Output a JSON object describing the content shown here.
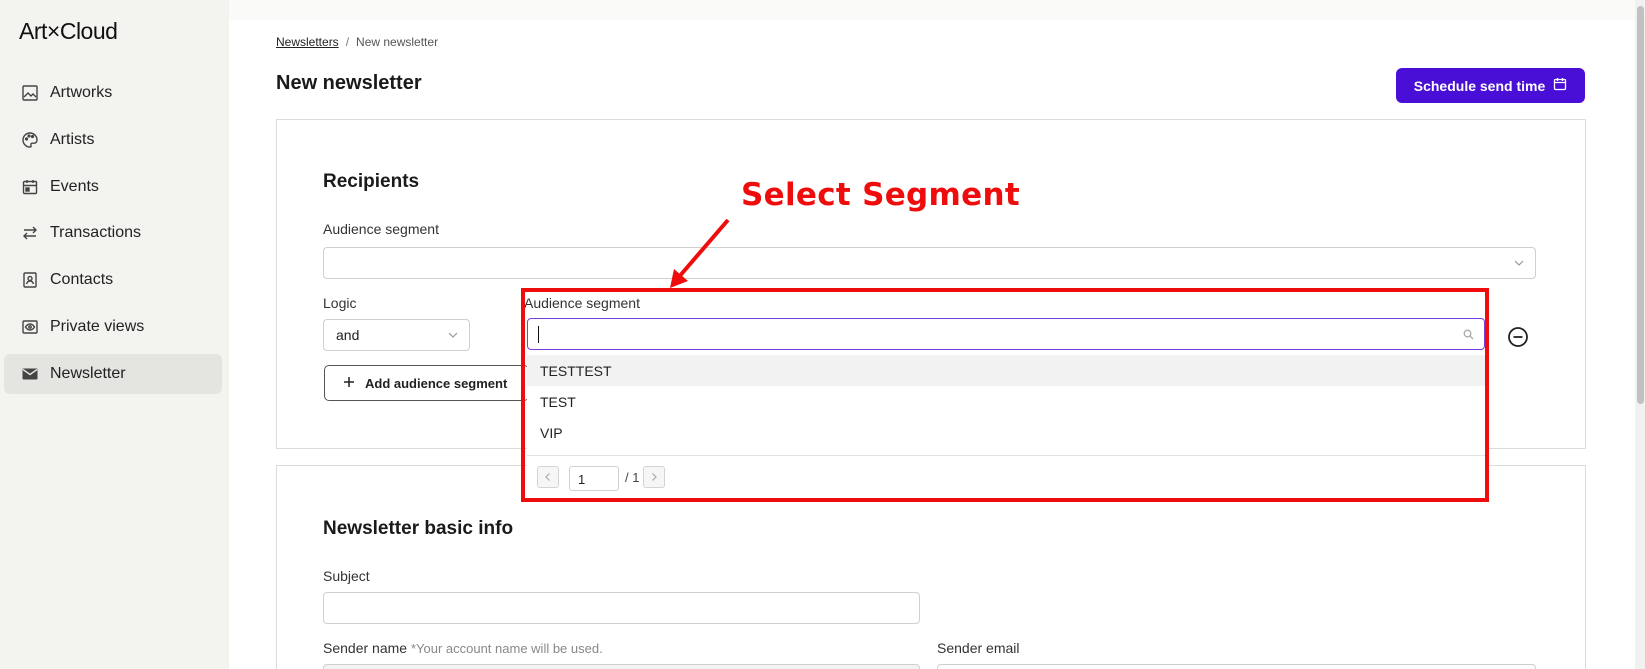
{
  "app": {
    "logo": "ArtXCloud"
  },
  "sidebar": {
    "items": [
      {
        "label": "Artworks",
        "icon": "image-icon"
      },
      {
        "label": "Artists",
        "icon": "palette-icon"
      },
      {
        "label": "Events",
        "icon": "calendar-icon"
      },
      {
        "label": "Transactions",
        "icon": "swap-arrows-icon"
      },
      {
        "label": "Contacts",
        "icon": "contact-card-icon"
      },
      {
        "label": "Private views",
        "icon": "eye-frame-icon"
      },
      {
        "label": "Newsletter",
        "icon": "envelope-icon",
        "active": true
      }
    ]
  },
  "breadcrumb": {
    "parent": "Newsletters",
    "separator": "/",
    "current": "New newsletter"
  },
  "header": {
    "title": "New newsletter",
    "schedule_label": "Schedule send time"
  },
  "recipients": {
    "title": "Recipients",
    "audience_label": "Audience segment",
    "audience_value": "",
    "logic_label": "Logic",
    "logic_value": "and",
    "add_label": "Add audience segment"
  },
  "dropdown": {
    "label": "Audience segment",
    "search_value": "",
    "options": [
      "TESTTEST",
      "TEST",
      "VIP"
    ],
    "page_current": "1",
    "page_total": "/ 1"
  },
  "basic_info": {
    "title": "Newsletter basic info",
    "subject_label": "Subject",
    "subject_value": "",
    "sender_name_label": "Sender name",
    "sender_name_hint": "*Your account name will be used.",
    "sender_email_label": "Sender email"
  },
  "annotation": {
    "text": "Select Segment"
  },
  "colors": {
    "accent": "#4a0fd6",
    "annotation": "#ee0c0c",
    "focus": "#7b3fe4"
  }
}
